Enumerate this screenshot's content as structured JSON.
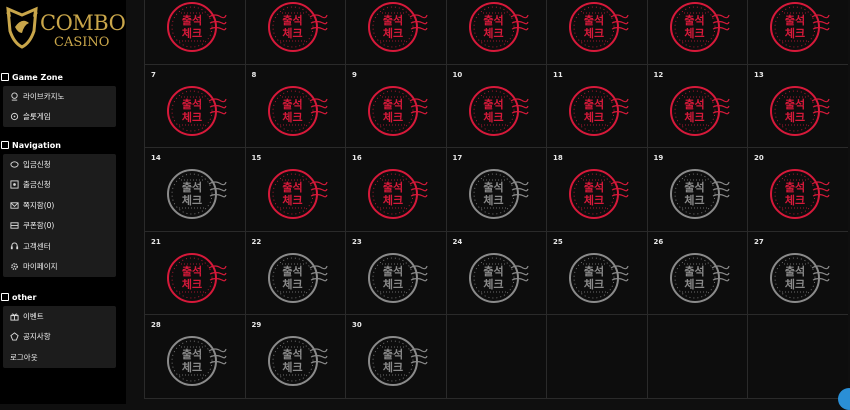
{
  "brand": {
    "line1": "COMBO",
    "line2": "CASINO",
    "gold": "#c9a64a"
  },
  "sidebar": {
    "sections": [
      {
        "title": "Game Zone",
        "icon": "gamepad-icon",
        "items": [
          {
            "label": "라이브카지노",
            "icon": "cards-icon"
          },
          {
            "label": "슬롯게임",
            "icon": "slot-icon"
          }
        ]
      },
      {
        "title": "Navigation",
        "icon": "navigation-icon",
        "items": [
          {
            "label": "입금신청",
            "icon": "deposit-icon"
          },
          {
            "label": "출금신청",
            "icon": "withdraw-icon"
          },
          {
            "label": "쪽지함(0)",
            "icon": "mail-icon"
          },
          {
            "label": "쿠폰함(0)",
            "icon": "coupon-icon"
          },
          {
            "label": "고객센터",
            "icon": "headset-icon"
          },
          {
            "label": "마이페이지",
            "icon": "gear-icon"
          }
        ]
      },
      {
        "title": "other",
        "icon": "other-icon",
        "items": [
          {
            "label": "이벤트",
            "icon": "gift-icon"
          },
          {
            "label": "공지사항",
            "icon": "notice-icon"
          },
          {
            "label": "로그아웃",
            "icon": ""
          }
        ]
      }
    ]
  },
  "calendar": {
    "stamp_line1": "출석",
    "stamp_line2": "체크",
    "colors": {
      "attended": "#d6193a",
      "missed": "#8a8a8a"
    },
    "days": [
      {
        "day": "",
        "status": "red"
      },
      {
        "day": "",
        "status": "red"
      },
      {
        "day": "",
        "status": "red"
      },
      {
        "day": "",
        "status": "red"
      },
      {
        "day": "",
        "status": "red"
      },
      {
        "day": "",
        "status": "red"
      },
      {
        "day": "",
        "status": "red"
      },
      {
        "day": "7",
        "status": "red"
      },
      {
        "day": "8",
        "status": "red"
      },
      {
        "day": "9",
        "status": "red"
      },
      {
        "day": "10",
        "status": "red"
      },
      {
        "day": "11",
        "status": "red"
      },
      {
        "day": "12",
        "status": "red"
      },
      {
        "day": "13",
        "status": "red"
      },
      {
        "day": "14",
        "status": "gray"
      },
      {
        "day": "15",
        "status": "red"
      },
      {
        "day": "16",
        "status": "red"
      },
      {
        "day": "17",
        "status": "gray"
      },
      {
        "day": "18",
        "status": "red"
      },
      {
        "day": "19",
        "status": "gray"
      },
      {
        "day": "20",
        "status": "red"
      },
      {
        "day": "21",
        "status": "red"
      },
      {
        "day": "22",
        "status": "gray"
      },
      {
        "day": "23",
        "status": "gray"
      },
      {
        "day": "24",
        "status": "gray"
      },
      {
        "day": "25",
        "status": "gray"
      },
      {
        "day": "26",
        "status": "gray"
      },
      {
        "day": "27",
        "status": "gray"
      },
      {
        "day": "28",
        "status": "gray"
      },
      {
        "day": "29",
        "status": "gray"
      },
      {
        "day": "30",
        "status": "gray"
      },
      {
        "day": "",
        "status": "empty"
      },
      {
        "day": "",
        "status": "empty"
      },
      {
        "day": "",
        "status": "empty"
      },
      {
        "day": "",
        "status": "empty"
      }
    ]
  }
}
